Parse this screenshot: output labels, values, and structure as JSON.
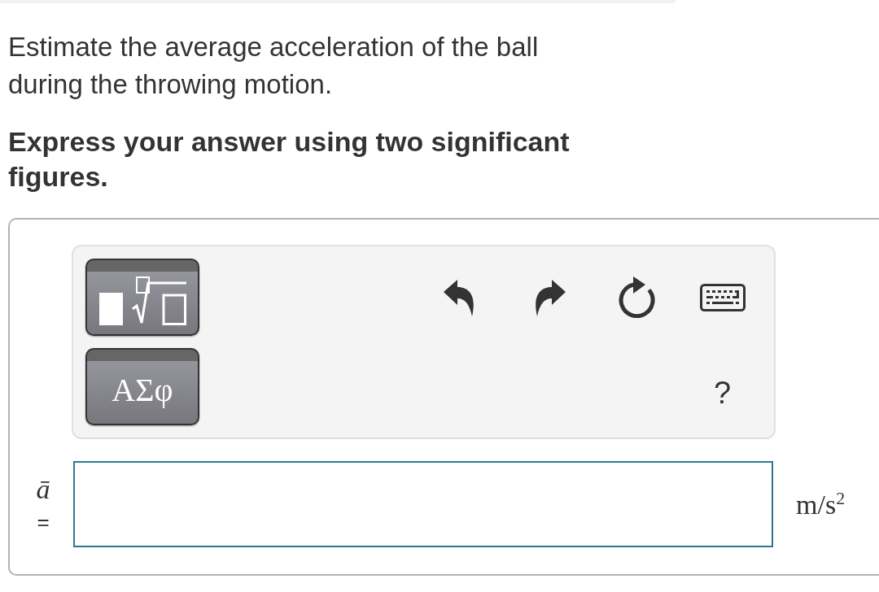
{
  "question": {
    "text": "Estimate the average acceleration of the ball during the throwing motion.",
    "instruction": "Express your answer using two significant figures."
  },
  "answer": {
    "palette_buttons": [
      {
        "kind": "templates"
      },
      {
        "kind": "greek",
        "label": "ΑΣφ"
      }
    ],
    "actions": [
      {
        "kind": "undo"
      },
      {
        "kind": "redo"
      },
      {
        "kind": "reset"
      },
      {
        "kind": "keyboard"
      }
    ],
    "help": "?",
    "variable": "ā",
    "equals": "=",
    "units": "m/s$^{2}$"
  }
}
